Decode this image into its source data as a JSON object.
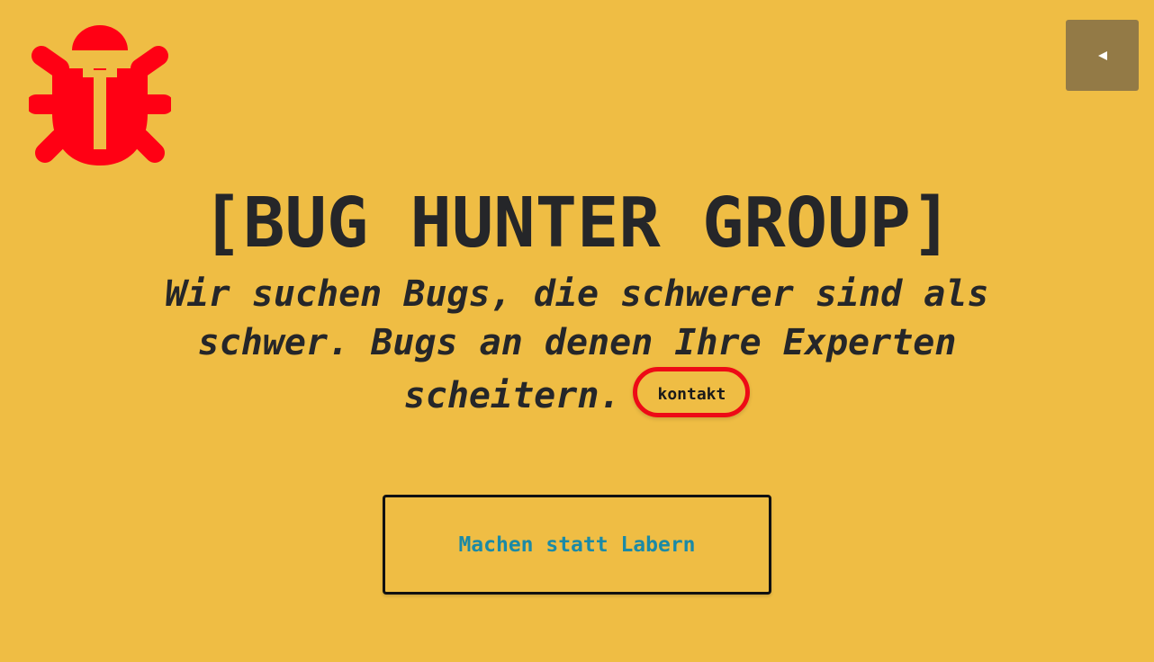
{
  "header": {
    "logo_icon": "bug-icon",
    "logo_color": "#ff0014",
    "menu_toggle_icon": "caret-left-icon"
  },
  "hero": {
    "title": "[BUG HUNTER GROUP]",
    "tagline": "Wir suchen Bugs, die schwerer sind als schwer. Bugs an denen Ihre Experten scheitern.",
    "contact_label": "kontakt",
    "cta_label": "Machen statt Labern"
  },
  "colors": {
    "background": "#efbd44",
    "text": "#252629",
    "accent_red": "#ee0a16",
    "cta_text": "#1b8aa6",
    "toggle_bg": "#937a46"
  }
}
